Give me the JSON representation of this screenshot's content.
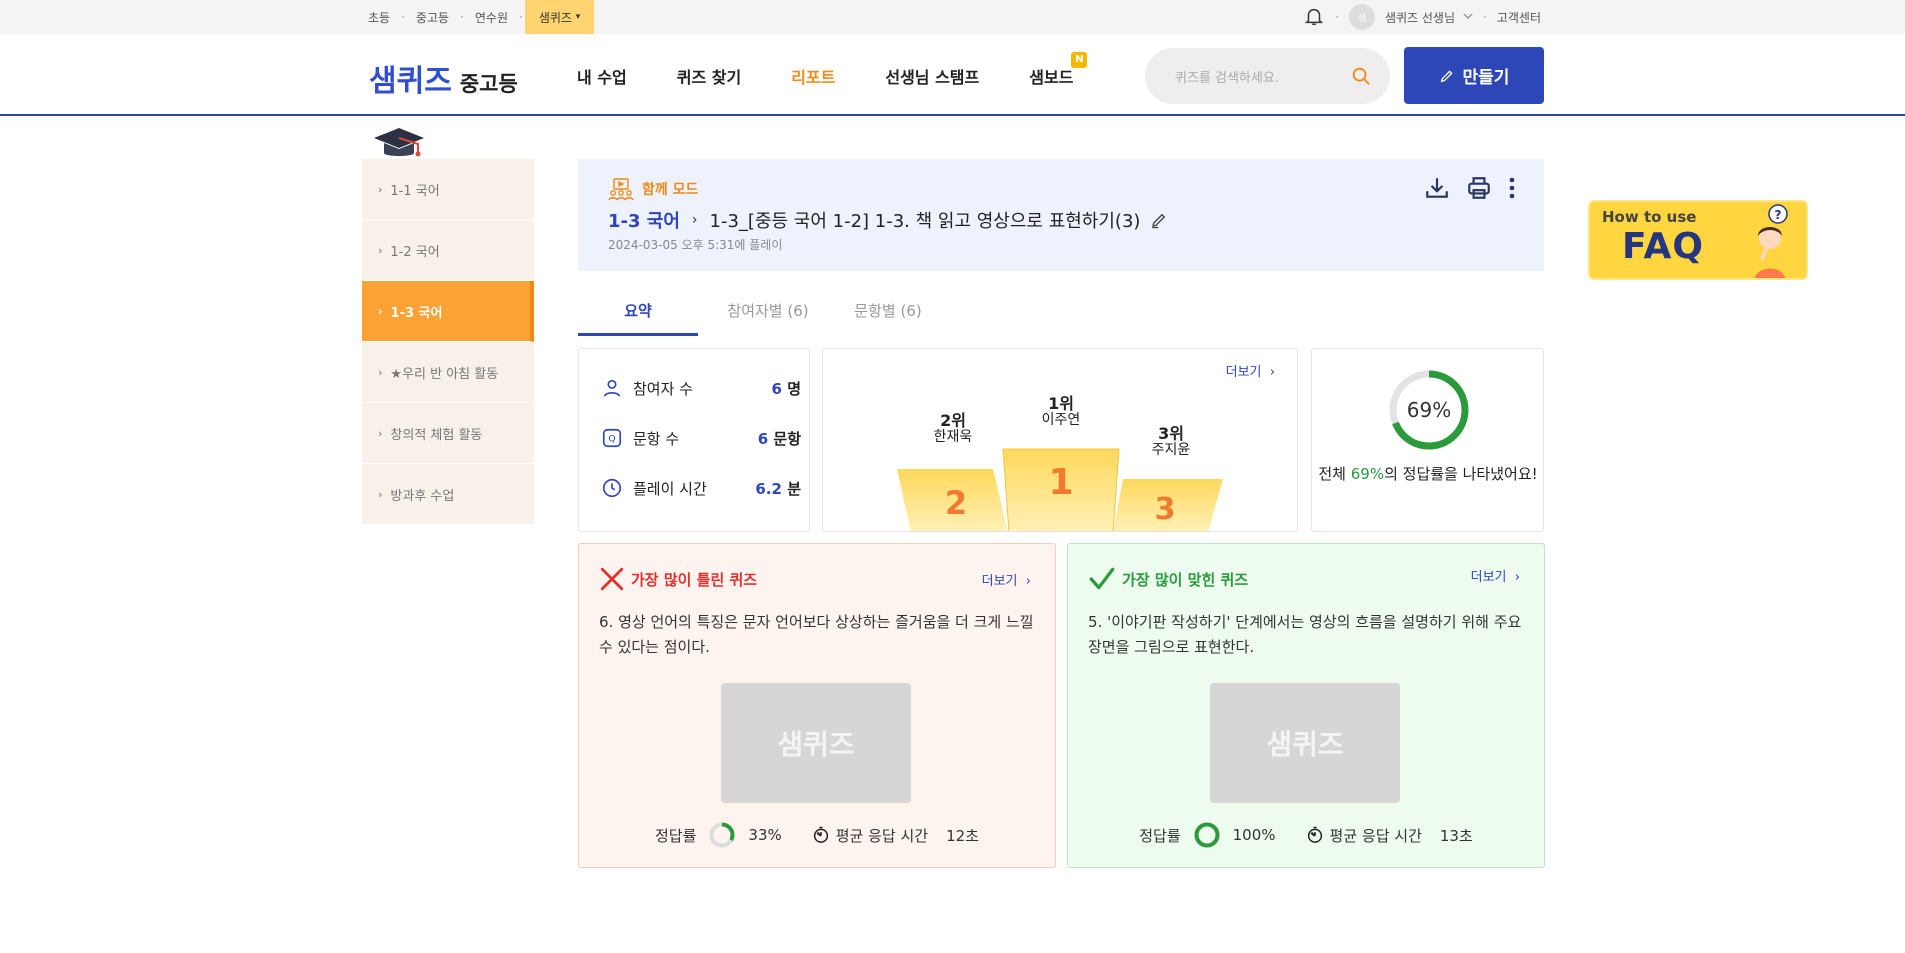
{
  "topbar": {
    "links": [
      "초등",
      "중고등",
      "연수원"
    ],
    "active": "샘퀴즈",
    "active_arrow": "▾",
    "user_initial": "샘",
    "user_name": "샘퀴즈 선생님",
    "support": "고객센터"
  },
  "header": {
    "logo_main": "샘퀴즈",
    "logo_sub": "중고등",
    "nav": [
      {
        "label": "내 수업"
      },
      {
        "label": "퀴즈 찾기"
      },
      {
        "label": "리포트"
      },
      {
        "label": "선생님 스탬프"
      },
      {
        "label": "샘보드",
        "badge": "N"
      }
    ],
    "search_placeholder": "퀴즈를 검색하세요.",
    "make_label": "만들기"
  },
  "sidebar": {
    "items": [
      {
        "label": "1-1 국어"
      },
      {
        "label": "1-2 국어"
      },
      {
        "label": "1-3 국어"
      },
      {
        "label": "★우리 반 아침 활동"
      },
      {
        "label": "창의적 체험 활동"
      },
      {
        "label": "방과후 수업"
      }
    ]
  },
  "report": {
    "mode": "함께 모드",
    "class": "1-3 국어",
    "title": "1-3_[중등 국어 1-2] 1-3. 책 읽고 영상으로 표현하기(3)",
    "date": "2024-03-05 오후 5:31에 플레이",
    "tabs": [
      "요약",
      "참여자별 (6)",
      "문항별 (6)"
    ]
  },
  "summary": {
    "participants_label": "참여자 수",
    "participants_value": "6",
    "participants_unit": "명",
    "questions_label": "문항 수",
    "questions_value": "6",
    "questions_unit": "문항",
    "playtime_label": "플레이 시간",
    "playtime_value": "6.2",
    "playtime_unit": "분",
    "more": "더보기",
    "ranks": [
      {
        "place": "1위",
        "name": "이주연",
        "num": "1"
      },
      {
        "place": "2위",
        "name": "한재욱",
        "num": "2"
      },
      {
        "place": "3위",
        "name": "주지윤",
        "num": "3"
      }
    ],
    "accuracy_text": "69%",
    "accuracy_value": 0.69,
    "accuracy_pre": "전체 ",
    "accuracy_pct": "69%",
    "accuracy_post": "의 정답률을 나타냈어요!"
  },
  "wrong_quiz": {
    "title": "가장 많이 틀린 퀴즈",
    "more": "더보기",
    "question": "6. 영상 언어의 특징은 문자 언어보다 상상하는 즐거움을 더 크게 느낄 수 있다는 점이다.",
    "thumb": "샘퀴즈",
    "rate_label": "정답률",
    "rate_text": "33%",
    "rate_value": 0.33,
    "time_label": "평균 응답 시간",
    "time_value": "12초"
  },
  "right_quiz": {
    "title": "가장 많이 맞힌 퀴즈",
    "more": "더보기",
    "question": "5. '이야기판 작성하기' 단계에서는 영상의 흐름을 설명하기 위해 주요 장면을 그림으로 표현한다.",
    "thumb": "샘퀴즈",
    "rate_label": "정답률",
    "rate_text": "100%",
    "rate_value": 1.0,
    "time_label": "평균 응답 시간",
    "time_value": "13초"
  },
  "faq": {
    "line1": "How to use",
    "line2": "FAQ"
  },
  "colors": {
    "brand_blue": "#2e47b8",
    "accent_orange": "#f08a1c",
    "correct_green": "#2a9a3c",
    "wrong_red": "#e0312f"
  }
}
